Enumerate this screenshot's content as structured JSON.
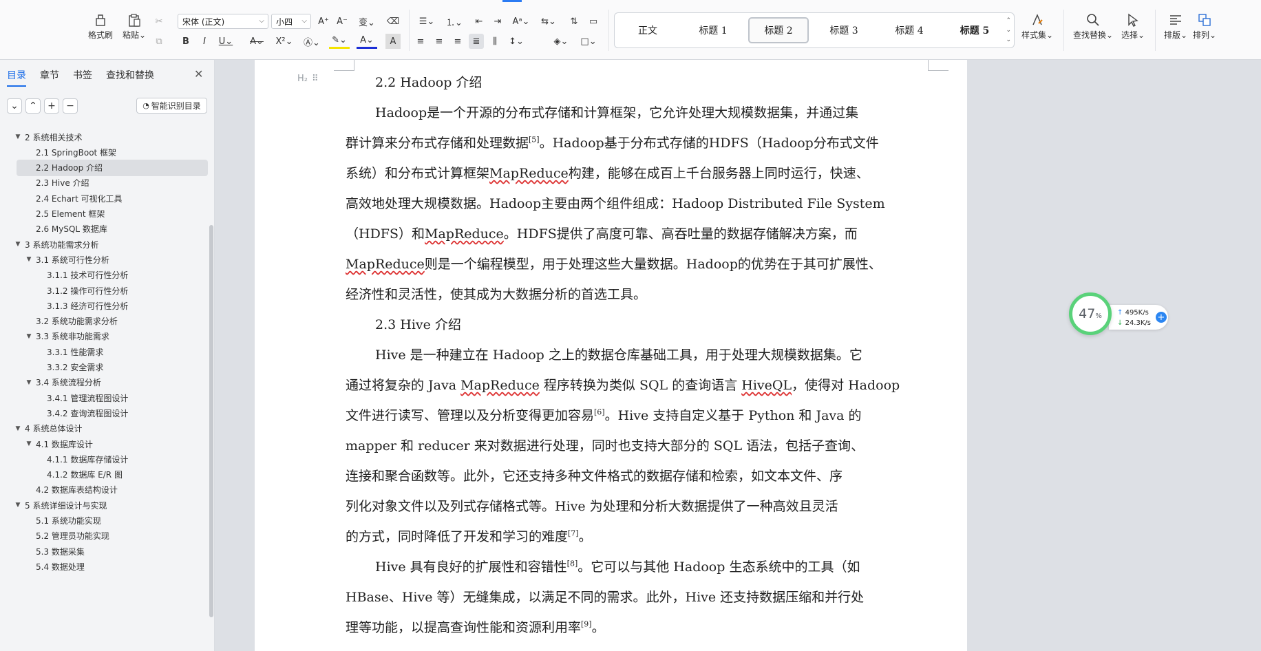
{
  "ribbon": {
    "format_painter": "格式刷",
    "paste": "粘贴",
    "font_name": "宋体 (正文)",
    "font_size": "小四",
    "styles": [
      "正文",
      "标题 1",
      "标题 2",
      "标题 3",
      "标题 4",
      "标题 5"
    ],
    "active_style_index": 2,
    "style_set": "样式集",
    "find_replace": "查找替换",
    "select": "选择",
    "layout": "排版",
    "arrange": "排列"
  },
  "sidebar": {
    "tabs": [
      "目录",
      "章节",
      "书签",
      "查找和替换"
    ],
    "smart_toc_button": "智能识别目录",
    "toc": [
      {
        "label": "2  系统相关技术",
        "level": 1,
        "expanded": true
      },
      {
        "label": "2.1 SpringBoot 框架",
        "level": 2
      },
      {
        "label": "2.2 Hadoop 介绍",
        "level": 2,
        "current": true
      },
      {
        "label": "2.3 Hive 介绍",
        "level": 2
      },
      {
        "label": "2.4 Echart 可视化工具",
        "level": 2
      },
      {
        "label": "2.5 Element 框架",
        "level": 2
      },
      {
        "label": "2.6 MySQL 数据库",
        "level": 2
      },
      {
        "label": "3  系统功能需求分析",
        "level": 1,
        "expanded": true
      },
      {
        "label": "3.1  系统可行性分析",
        "level": 2,
        "expanded": true
      },
      {
        "label": "3.1.1  技术可行性分析",
        "level": 3
      },
      {
        "label": "3.1.2  操作可行性分析",
        "level": 3
      },
      {
        "label": "3.1.3  经济可行性分析",
        "level": 3
      },
      {
        "label": "3.2  系统功能需求分析",
        "level": 2
      },
      {
        "label": "3.3  系统非功能需求",
        "level": 2,
        "expanded": true
      },
      {
        "label": "3.3.1  性能需求",
        "level": 3
      },
      {
        "label": "3.3.2  安全需求",
        "level": 3
      },
      {
        "label": "3.4  系统流程分析",
        "level": 2,
        "expanded": true
      },
      {
        "label": "3.4.1 管理流程图设计",
        "level": 3
      },
      {
        "label": "3.4.2 查询流程图设计",
        "level": 3
      },
      {
        "label": "4  系统总体设计",
        "level": 1,
        "expanded": true
      },
      {
        "label": "4.1  数据库设计",
        "level": 2,
        "expanded": true
      },
      {
        "label": "4.1.1  数据库存储设计",
        "level": 3
      },
      {
        "label": "4.1.2  数据库 E/R 图",
        "level": 3
      },
      {
        "label": "4.2  数据库表结构设计",
        "level": 2
      },
      {
        "label": "5  系统详细设计与实现",
        "level": 1,
        "expanded": true
      },
      {
        "label": "5.1  系统功能实现",
        "level": 2
      },
      {
        "label": "5.2  管理员功能实现",
        "level": 2
      },
      {
        "label": "5.3 数据采集",
        "level": 2
      },
      {
        "label": "5.4  数据处理",
        "level": 2
      }
    ]
  },
  "document": {
    "heading_marker": "H₂",
    "h_hadoop": "2.2 Hadoop 介绍",
    "p1": {
      "l1": "Hadoop是一个开源的分布式存储和计算框架，它允许处理大规模数据集，并通过集",
      "l2a": "群计算来分布式存储和处理数据",
      "l2ref": "[5]",
      "l2b": "。Hadoop基于分布式存储的HDFS（Hadoop分布式文件",
      "l3a": "系统）和分布式计算框架",
      "l3w": "MapReduce",
      "l3b": "构建，能够在成百上千台服务器上同时运行，快速、",
      "l4": "高效地处理大规模数据。Hadoop主要由两个组件组成：Hadoop Distributed File System",
      "l5a": "（HDFS）和",
      "l5w": "MapReduce",
      "l5b": "。HDFS提供了高度可靠、高吞吐量的数据存储解决方案，而",
      "l6w": "MapReduce",
      "l6b": "则是一个编程模型，用于处理这些大量数据。Hadoop的优势在于其可扩展性、",
      "l7": "经济性和灵活性，使其成为大数据分析的首选工具。"
    },
    "h_hive": "2.3 Hive 介绍",
    "p2": {
      "l1": "Hive 是一种建立在 Hadoop 之上的数据仓库基础工具，用于处理大规模数据集。它",
      "l2a": "通过将复杂的 Java ",
      "l2w1": "MapReduce",
      "l2b": " 程序转换为类似 SQL 的查询语言 ",
      "l2w2": "HiveQL",
      "l2c": "，使得对 Hadoop",
      "l3a": "文件进行读写、管理以及分析变得更加容易",
      "l3ref": "[6]",
      "l3b": "。Hive 支持自定义基于 Python 和 Java 的",
      "l4": "mapper 和 reducer 来对数据进行处理，同时也支持大部分的 SQL 语法，包括子查询、",
      "l5": "连接和聚合函数等。此外，它还支持多种文件格式的数据存储和检索，如文本文件、序",
      "l6": "列化对象文件以及列式存储格式等。Hive 为处理和分析大数据提供了一种高效且灵活",
      "l7a": "的方式，同时降低了开发和学习的难度",
      "l7ref": "[7]",
      "l7b": "。"
    },
    "p3": {
      "l1a": "Hive 具有良好的扩展性和容错性",
      "l1ref": "[8]",
      "l1b": "。它可以与其他 Hadoop 生态系统中的工具（如",
      "l2": "HBase、Hive 等）无缝集成，以满足不同的需求。此外，Hive 还支持数据压缩和并行处",
      "l3a": "理等功能，以提高查询性能和资源利用率",
      "l3ref": "[9]",
      "l3b": "。"
    }
  },
  "net_widget": {
    "percent": "47",
    "percent_unit": "%",
    "upload": "495K/s",
    "download": "24.3K/s"
  },
  "colors": {
    "accent": "#1a6ce8",
    "ring": "#5ad27a"
  }
}
